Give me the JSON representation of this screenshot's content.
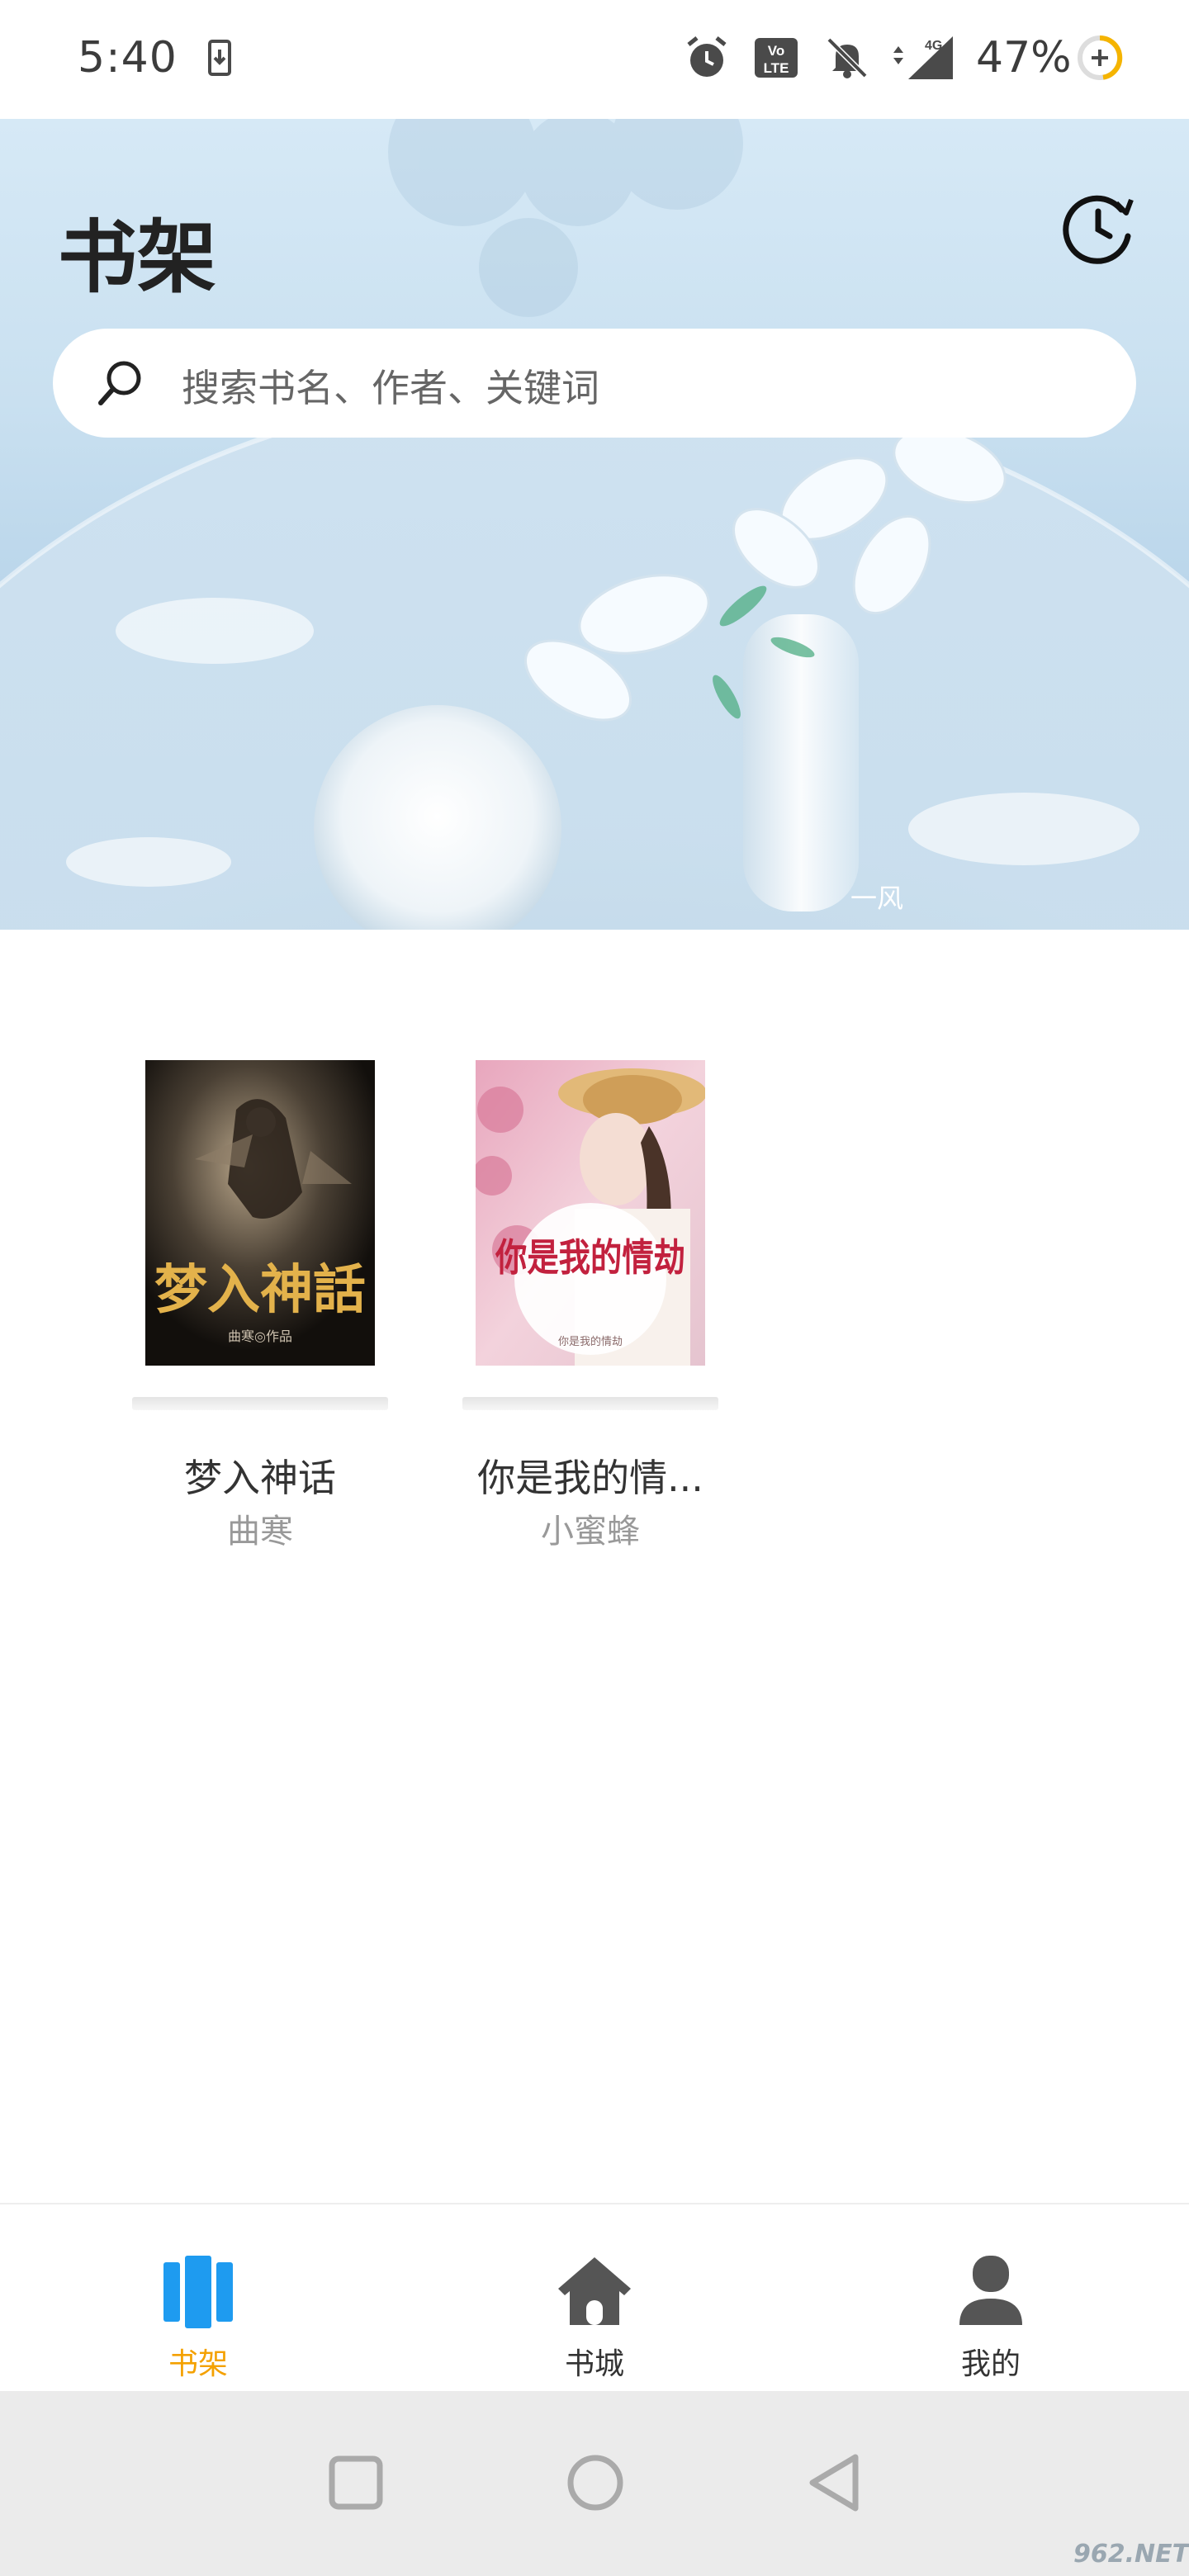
{
  "status_bar": {
    "time": "5:40",
    "battery_percent": "47%",
    "network": "4G",
    "icons": [
      "download-icon",
      "alarm-icon",
      "volte-icon",
      "mute-icon",
      "signal-icon",
      "battery-icon"
    ]
  },
  "header": {
    "title": "书架",
    "history_icon": "history-clock-icon"
  },
  "search": {
    "placeholder": "搜索书名、作者、关键词"
  },
  "hero": {
    "signature": "一风"
  },
  "books": [
    {
      "title": "梦入神话",
      "author": "曲寒",
      "cover_title": "梦入神話",
      "cover_sub": "曲寒◎作品"
    },
    {
      "title": "你是我的情...",
      "author": "小蜜蜂",
      "cover_title": "你是我的情劫",
      "cover_sub": "你是我的情劫"
    }
  ],
  "bottom_nav": {
    "items": [
      {
        "label": "书架",
        "icon": "bookshelf-icon",
        "active": true
      },
      {
        "label": "书城",
        "icon": "home-icon",
        "active": false
      },
      {
        "label": "我的",
        "icon": "profile-icon",
        "active": false
      }
    ],
    "active_color": "#f4a100",
    "active_icon_color": "#1e9bf0"
  },
  "system_nav": {
    "buttons": [
      "recents-square-icon",
      "home-circle-icon",
      "back-triangle-icon"
    ]
  },
  "watermark": "962.NET"
}
